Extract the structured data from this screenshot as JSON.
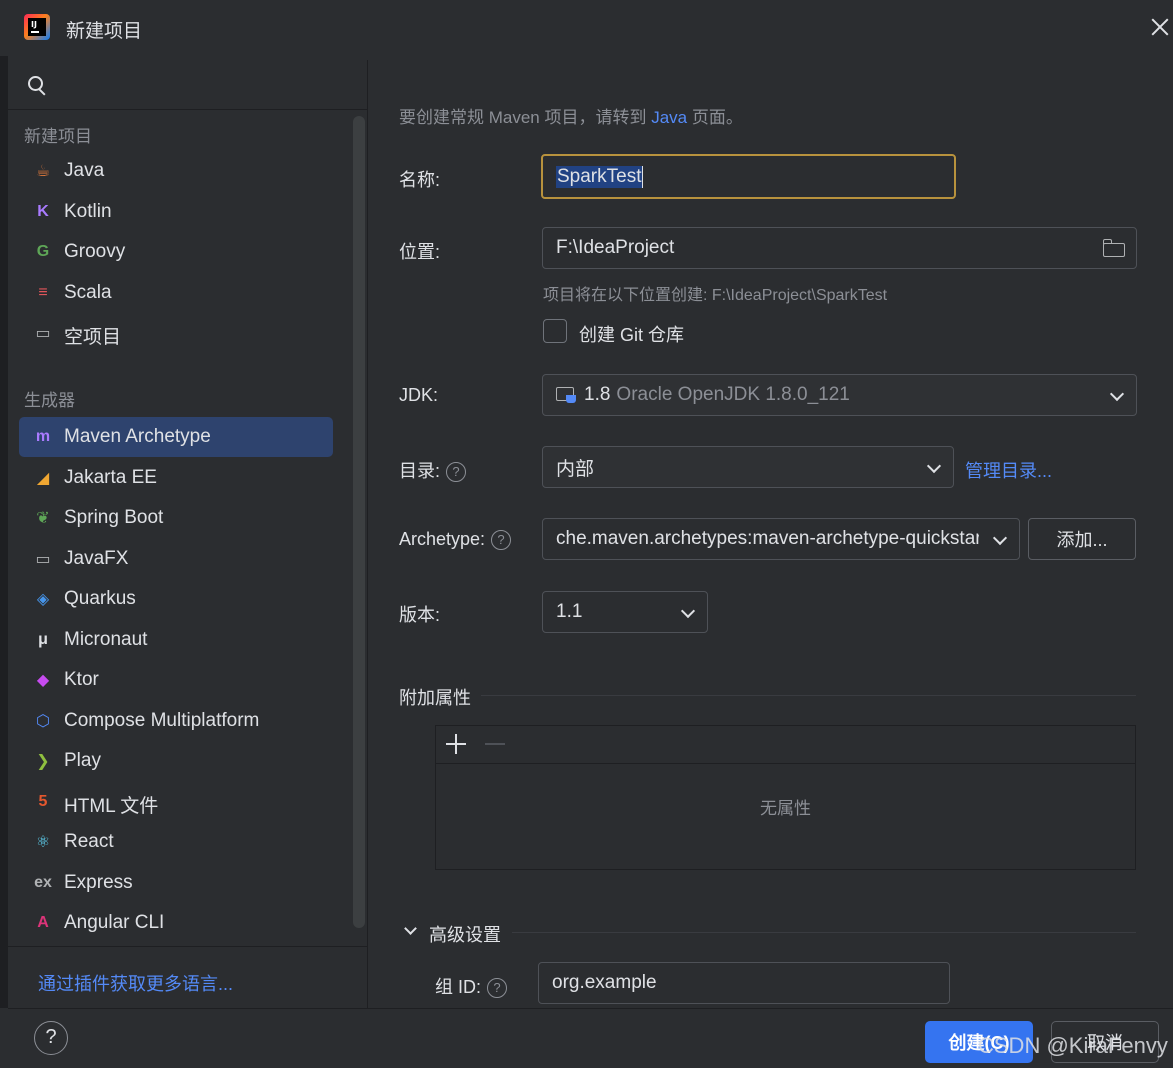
{
  "window": {
    "title": "新建项目"
  },
  "sidebar": {
    "new_project_header": "新建项目",
    "generators_header": "生成器",
    "project_types": [
      {
        "label": "Java",
        "icon": "java-cup-icon",
        "color": "#e07a3c"
      },
      {
        "label": "Kotlin",
        "icon": "kotlin-icon",
        "color": "#a97bff"
      },
      {
        "label": "Groovy",
        "icon": "groovy-icon",
        "color": "#5ea657"
      },
      {
        "label": "Scala",
        "icon": "scala-icon",
        "color": "#e0555a"
      },
      {
        "label": "空项目",
        "icon": "empty-project-icon",
        "color": "#afb1b3"
      }
    ],
    "generators": [
      {
        "label": "Maven Archetype",
        "icon": "maven-icon",
        "color": "#a97bff",
        "selected": true
      },
      {
        "label": "Jakarta EE",
        "icon": "jakarta-icon",
        "color": "#f0a732"
      },
      {
        "label": "Spring Boot",
        "icon": "spring-boot-icon",
        "color": "#5ea657"
      },
      {
        "label": "JavaFX",
        "icon": "javafx-icon",
        "color": "#afb1b3"
      },
      {
        "label": "Quarkus",
        "icon": "quarkus-icon",
        "color": "#4695eb"
      },
      {
        "label": "Micronaut",
        "icon": "micronaut-icon",
        "color": "#dfe1e5"
      },
      {
        "label": "Ktor",
        "icon": "ktor-icon",
        "color": "#c74bf0"
      },
      {
        "label": "Compose Multiplatform",
        "icon": "compose-icon",
        "color": "#548af7"
      },
      {
        "label": "Play",
        "icon": "play-icon",
        "color": "#8fbf3f"
      },
      {
        "label": "HTML 文件",
        "icon": "html5-icon",
        "color": "#e4572e"
      },
      {
        "label": "React",
        "icon": "react-icon",
        "color": "#61dafb"
      },
      {
        "label": "Express",
        "icon": "express-icon",
        "color": "#afb1b3"
      },
      {
        "label": "Angular CLI",
        "icon": "angular-icon",
        "color": "#dd3479"
      }
    ],
    "plugins_link": "通过插件获取更多语言..."
  },
  "form": {
    "hint_prefix": "要创建常规 Maven 项目，请转到",
    "hint_link": "Java",
    "hint_suffix": "页面。",
    "name_label": "名称:",
    "name_value": "SparkTest",
    "location_label": "位置:",
    "location_value": "F:\\IdeaProject",
    "location_hint": "项目将在以下位置创建: F:\\IdeaProject\\SparkTest",
    "git_label": "创建 Git 仓库",
    "git_checked": false,
    "jdk_label": "JDK:",
    "jdk_version": "1.8",
    "jdk_vendor": "Oracle OpenJDK 1.8.0_121",
    "catalog_label": "目录:",
    "catalog_value": "内部",
    "manage_catalogs": "管理目录...",
    "archetype_label": "Archetype:",
    "archetype_value": "che.maven.archetypes:maven-archetype-quickstart",
    "add_button": "添加...",
    "version_label": "版本:",
    "version_value": "1.1",
    "extra_props_title": "附加属性",
    "no_props": "无属性",
    "advanced_title": "高级设置",
    "group_id_label": "组 ID:",
    "group_id_value": "org.example"
  },
  "footer": {
    "help": "?",
    "create_button": "创建(C)",
    "cancel_button": "取消",
    "watermark": "CSDN @KiraFenvy"
  },
  "colors": {
    "accent": "#3574f0",
    "link": "#548af7",
    "selection": "#2e436e",
    "focus_border": "#b8923d"
  }
}
